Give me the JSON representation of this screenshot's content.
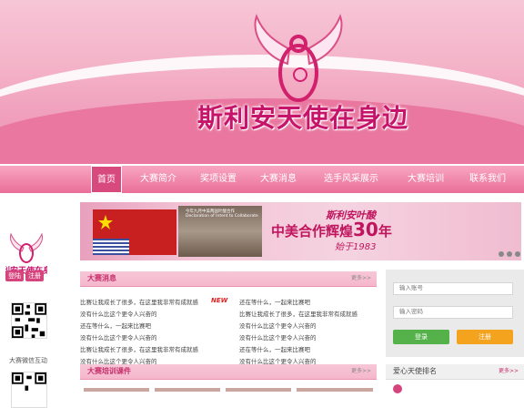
{
  "banner": {
    "title": "斯利安天使在身边"
  },
  "nav": {
    "items": [
      "首页",
      "大赛简介",
      "奖项设置",
      "大赛消息",
      "选手风采展示",
      "大赛培训",
      "联系我们"
    ]
  },
  "left": {
    "login_label": "登陆",
    "register_label": "注册",
    "qr_label": "大赛微信互动"
  },
  "slider": {
    "brand": "斯利安叶酸",
    "headline_prefix": "中美合作辉煌",
    "headline_number": "30",
    "headline_suffix": "年",
    "since": "始于1983",
    "photo_caption": "今年九月中美两国叶酸合作",
    "photo_caption2": "Declaration of Intent to Collaborate"
  },
  "news": {
    "title": "大赛消息",
    "more": "更多>>",
    "new_badge": "NEW",
    "left_items": [
      "比赛让我成长了很多，在这里我非常有成就感",
      "没有什么比这个更令人兴奋的",
      "还在等什么，一起来比赛吧",
      "没有什么比这个更令人兴奋的",
      "比赛让我成长了很多，在这里我非常有成就感",
      "没有什么比这个更令人兴奋的"
    ],
    "right_items": [
      "还在等什么，一起来比赛吧",
      "比赛让我成长了很多，在这里我非常有成就感",
      "没有什么比这个更令人兴奋的",
      "没有什么比这个更令人兴奋的",
      "还在等什么，一起来比赛吧",
      "没有什么比这个更令人兴奋的"
    ]
  },
  "training": {
    "title": "大赛培训课件",
    "more": "更多>>"
  },
  "login": {
    "account_placeholder": "输入账号",
    "password_placeholder": "输入密码",
    "login_label": "登录",
    "register_label": "注册"
  },
  "rank": {
    "title": "爱心天使排名",
    "more": "更多>>"
  },
  "colors": {
    "brand_pink": "#d5447c",
    "nav_pink": "#ea6e98",
    "login_green": "#55b24a",
    "register_orange": "#f3a31e"
  }
}
